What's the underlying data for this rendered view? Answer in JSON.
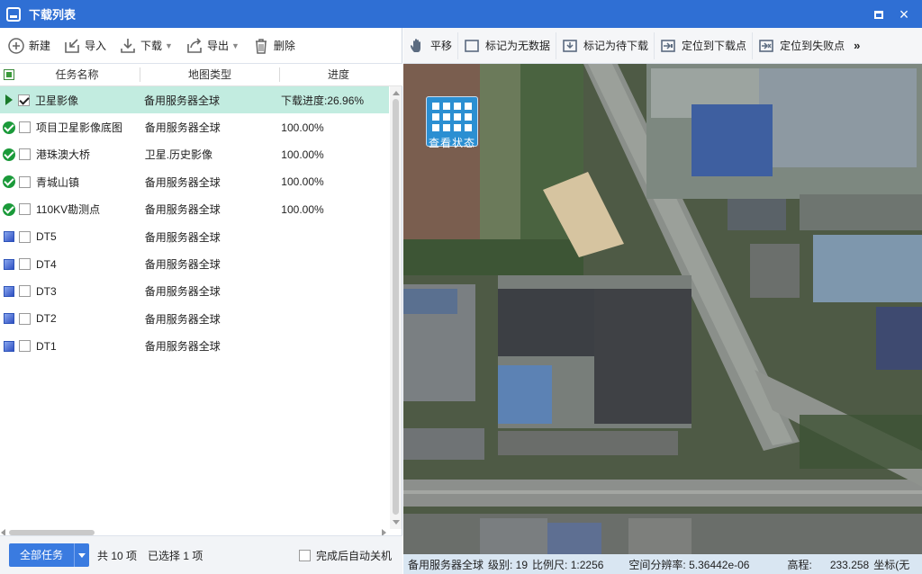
{
  "window": {
    "title": "下载列表",
    "maximize_icon": "maximize-icon",
    "close_icon": "close-icon",
    "close_glyph": "×"
  },
  "left_toolbar": {
    "new_label": "新建",
    "import_label": "导入",
    "download_label": "下载",
    "export_label": "导出",
    "delete_label": "删除"
  },
  "table": {
    "columns": [
      "任务名称",
      "地图类型",
      "进度"
    ],
    "rows": [
      {
        "status": "downloading",
        "checked": true,
        "name": "卫星影像",
        "type": "备用服务器全球",
        "progress": "下载进度:26.96%"
      },
      {
        "status": "done",
        "checked": false,
        "name": "项目卫星影像底图",
        "type": "备用服务器全球",
        "progress": "100.00%"
      },
      {
        "status": "done",
        "checked": false,
        "name": "港珠澳大桥",
        "type": "卫星.历史影像",
        "progress": "100.00%"
      },
      {
        "status": "done",
        "checked": false,
        "name": "青城山镇",
        "type": "备用服务器全球",
        "progress": "100.00%"
      },
      {
        "status": "done",
        "checked": false,
        "name": "110KV勘测点",
        "type": "备用服务器全球",
        "progress": "100.00%"
      },
      {
        "status": "pending",
        "checked": false,
        "name": "DT5",
        "type": "备用服务器全球",
        "progress": ""
      },
      {
        "status": "pending",
        "checked": false,
        "name": "DT4",
        "type": "备用服务器全球",
        "progress": ""
      },
      {
        "status": "pending",
        "checked": false,
        "name": "DT3",
        "type": "备用服务器全球",
        "progress": ""
      },
      {
        "status": "pending",
        "checked": false,
        "name": "DT2",
        "type": "备用服务器全球",
        "progress": ""
      },
      {
        "status": "pending",
        "checked": false,
        "name": "DT1",
        "type": "备用服务器全球",
        "progress": ""
      }
    ]
  },
  "footer": {
    "all_tasks_label": "全部任务",
    "count_label": "共 10 项",
    "selected_label": "已选择 1 项",
    "auto_shutdown_label": "完成后自动关机"
  },
  "right_toolbar": {
    "pan_label": "平移",
    "mark_no_data_label": "标记为无数据",
    "mark_pending_label": "标记为待下载",
    "locate_download_label": "定位到下载点",
    "locate_failed_label": "定位到失败点",
    "more_label": "»"
  },
  "map": {
    "view_status_label": "查看状态"
  },
  "statusbar": {
    "server": "备用服务器全球",
    "level": "级别: 19",
    "scale": "比例尺: 1:2256",
    "resolution": "空间分辨率: 5.36442e-06",
    "elevation": "高程:      233.258",
    "coords": "坐标(无"
  },
  "colors": {
    "titlebar": "#2f6fd4",
    "selected_row": "#c2ece0",
    "done_status": "#1b9a3a",
    "pending_status": "#2f4fc2",
    "primary_button": "#3a7be0",
    "statusbar": "#d9e6f2"
  }
}
